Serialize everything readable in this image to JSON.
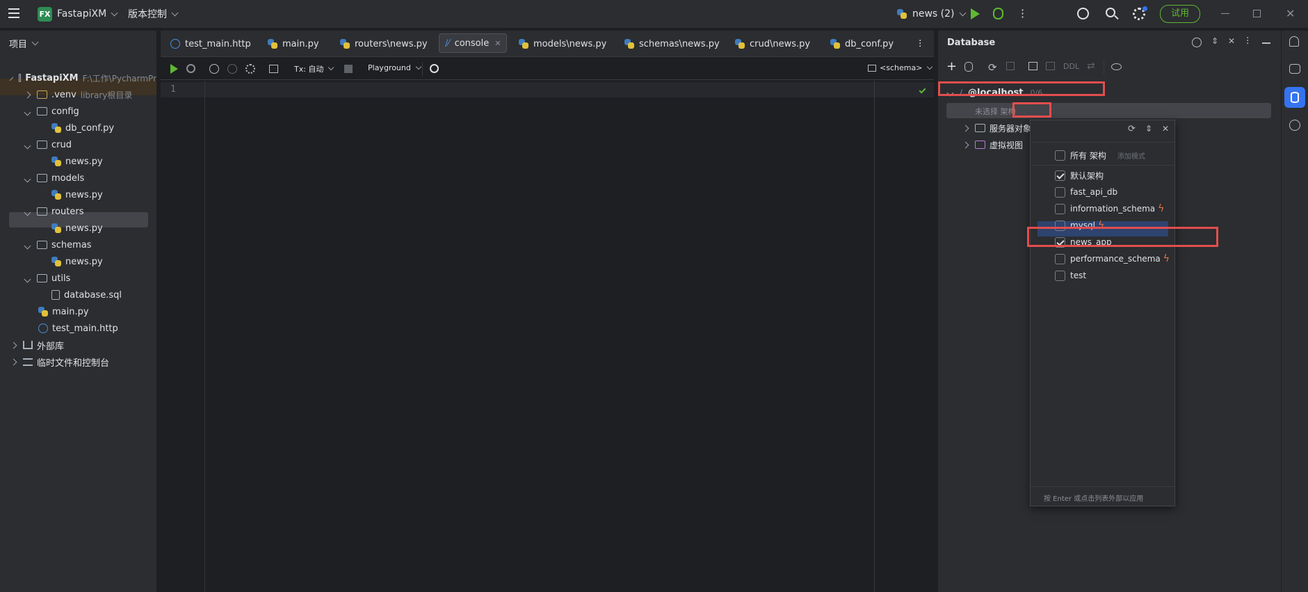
{
  "title_bar": {
    "project_badge": "FX",
    "project_name": "FastapiXM",
    "vcs_label": "版本控制",
    "run_config": "news (2)",
    "trial_button": "试用"
  },
  "project_panel": {
    "header": "项目",
    "tree": [
      {
        "label": "FastapiXM",
        "hint": "F:\\工作\\PycharmPr",
        "type": "root"
      },
      {
        "label": ".venv",
        "hint": "library根目录",
        "type": "folder"
      },
      {
        "label": "config",
        "type": "folder"
      },
      {
        "label": "db_conf.py",
        "type": "py"
      },
      {
        "label": "crud",
        "type": "folder"
      },
      {
        "label": "news.py",
        "type": "py"
      },
      {
        "label": "models",
        "type": "folder"
      },
      {
        "label": "news.py",
        "type": "py"
      },
      {
        "label": "routers",
        "type": "folder"
      },
      {
        "label": "news.py",
        "type": "py"
      },
      {
        "label": "schemas",
        "type": "folder"
      },
      {
        "label": "news.py",
        "type": "py"
      },
      {
        "label": "utils",
        "type": "folder"
      },
      {
        "label": "database.sql",
        "type": "sql"
      },
      {
        "label": "main.py",
        "type": "py"
      },
      {
        "label": "test_main.http",
        "type": "http"
      },
      {
        "label": "外部库",
        "type": "lib"
      },
      {
        "label": "临时文件和控制台",
        "type": "scratch"
      }
    ]
  },
  "editor": {
    "tabs": [
      "test_main.http",
      "main.py",
      "routers\\news.py",
      "console",
      "models\\news.py",
      "schemas\\news.py",
      "crud\\news.py",
      "db_conf.py"
    ],
    "active_tab": "console",
    "toolbar": {
      "tx_label": "Tx: 自动",
      "playground_label": "Playground",
      "schema_label": "<schema>"
    },
    "line_number": "1"
  },
  "database_panel": {
    "title": "Database",
    "ddl_label": "DDL",
    "connection": "@localhost",
    "connection_count": "0/6",
    "schema_row": "未选择 架构",
    "nodes": [
      "服务器对象",
      "虚拟视图"
    ],
    "popup": {
      "all_schemas": "所有 架构",
      "add_pattern": "添加模式",
      "schemas": [
        {
          "name": "默认架构",
          "checked": true,
          "bolt": false
        },
        {
          "name": "fast_api_db",
          "checked": false,
          "bolt": false
        },
        {
          "name": "information_schema",
          "checked": false,
          "bolt": true
        },
        {
          "name": "mysql",
          "checked": false,
          "bolt": true
        },
        {
          "name": "news_app",
          "checked": true,
          "bolt": false
        },
        {
          "name": "performance_schema",
          "checked": false,
          "bolt": true
        },
        {
          "name": "test",
          "checked": false,
          "bolt": false
        }
      ],
      "footer": "按 Enter 或点击列表外部以应用"
    }
  },
  "colors": {
    "accent": "#3574f0",
    "selection": "#2e436e",
    "highlight_box": "#e34d4d",
    "run_green": "#5fb832"
  }
}
